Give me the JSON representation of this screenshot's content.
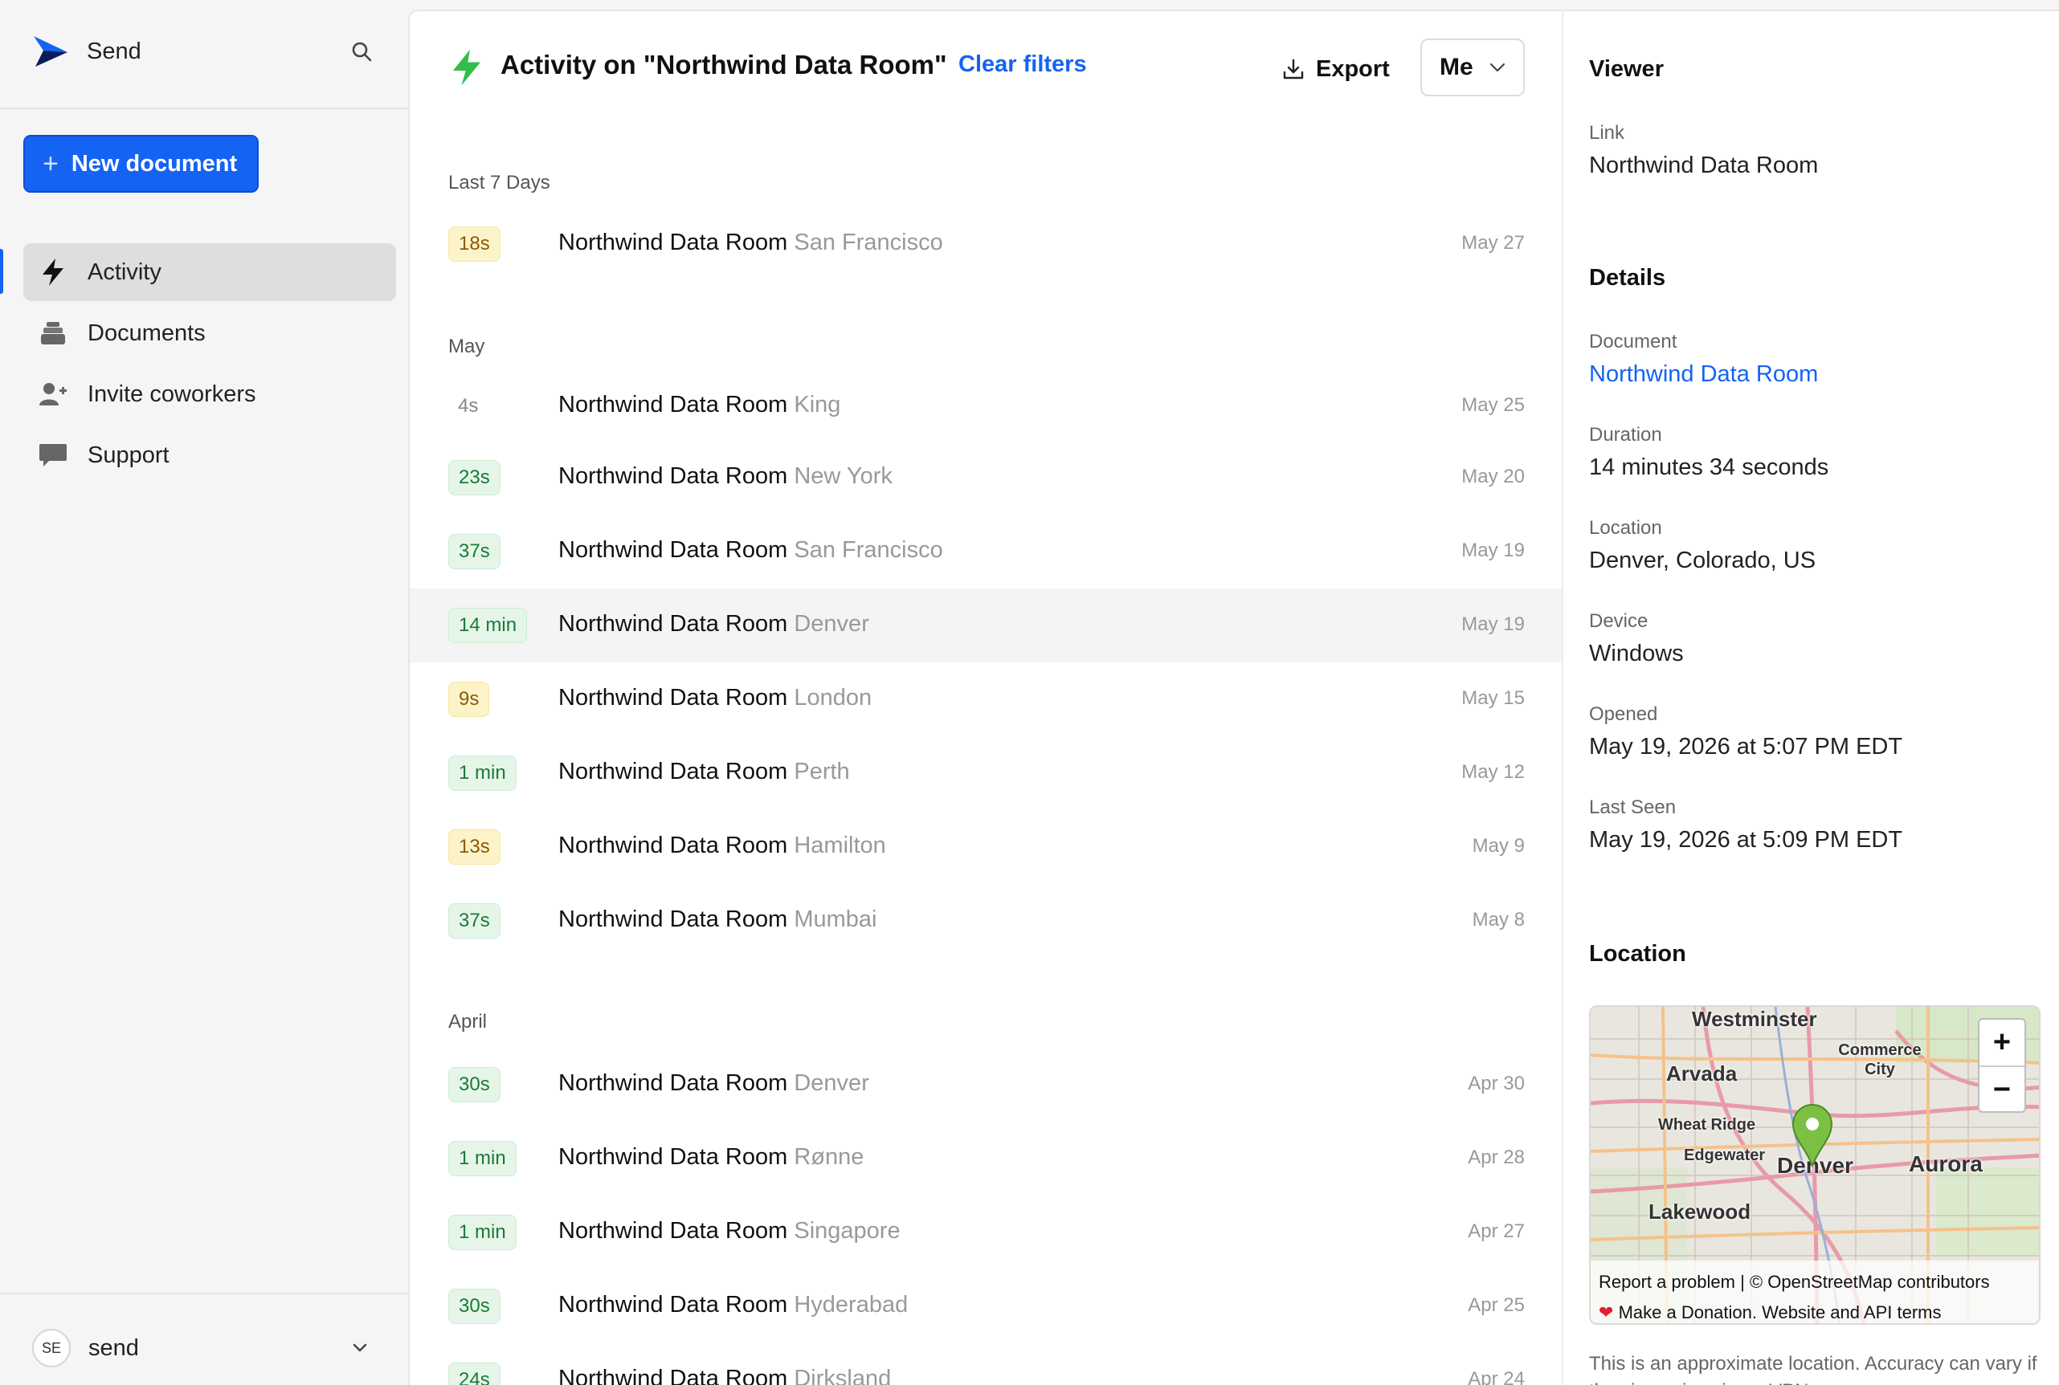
{
  "sidebar": {
    "brand": "Send",
    "new_document": "New document",
    "nav": [
      {
        "label": "Activity",
        "icon": "bolt-icon"
      },
      {
        "label": "Documents",
        "icon": "documents-icon"
      },
      {
        "label": "Invite coworkers",
        "icon": "user-plus-icon"
      },
      {
        "label": "Support",
        "icon": "chat-icon"
      }
    ],
    "account": {
      "initials": "SE",
      "name": "send"
    }
  },
  "main": {
    "title": "Activity on \"Northwind Data Room\"",
    "clear_filters": "Clear filters",
    "export": "Export",
    "filter": "Me",
    "sections": [
      {
        "label": "Last 7 Days",
        "rows": [
          {
            "duration": "18s",
            "doc": "Northwind Data Room",
            "location": "San Francisco",
            "date": "May 27",
            "badge": "yellow"
          }
        ]
      },
      {
        "label": "May",
        "rows": [
          {
            "duration": "4s",
            "doc": "Northwind Data Room",
            "location": "King",
            "date": "May 25",
            "badge": "plain"
          },
          {
            "duration": "23s",
            "doc": "Northwind Data Room",
            "location": "New York",
            "date": "May 20",
            "badge": "green"
          },
          {
            "duration": "37s",
            "doc": "Northwind Data Room",
            "location": "San Francisco",
            "date": "May 19",
            "badge": "green"
          },
          {
            "duration": "14 min",
            "doc": "Northwind Data Room",
            "location": "Denver",
            "date": "May 19",
            "badge": "green",
            "selected": true
          },
          {
            "duration": "9s",
            "doc": "Northwind Data Room",
            "location": "London",
            "date": "May 15",
            "badge": "yellow"
          },
          {
            "duration": "1 min",
            "doc": "Northwind Data Room",
            "location": "Perth",
            "date": "May 12",
            "badge": "green"
          },
          {
            "duration": "13s",
            "doc": "Northwind Data Room",
            "location": "Hamilton",
            "date": "May 9",
            "badge": "yellow"
          },
          {
            "duration": "37s",
            "doc": "Northwind Data Room",
            "location": "Mumbai",
            "date": "May 8",
            "badge": "green"
          }
        ]
      },
      {
        "label": "April",
        "rows": [
          {
            "duration": "30s",
            "doc": "Northwind Data Room",
            "location": "Denver",
            "date": "Apr 30",
            "badge": "green"
          },
          {
            "duration": "1 min",
            "doc": "Northwind Data Room",
            "location": "Rønne",
            "date": "Apr 28",
            "badge": "green"
          },
          {
            "duration": "1 min",
            "doc": "Northwind Data Room",
            "location": "Singapore",
            "date": "Apr 27",
            "badge": "green"
          },
          {
            "duration": "30s",
            "doc": "Northwind Data Room",
            "location": "Hyderabad",
            "date": "Apr 25",
            "badge": "green"
          },
          {
            "duration": "24s",
            "doc": "Northwind Data Room",
            "location": "Dirksland",
            "date": "Apr 24",
            "badge": "green"
          }
        ]
      }
    ]
  },
  "panel": {
    "viewer_heading": "Viewer",
    "link_label": "Link",
    "link_value": "Northwind Data Room",
    "details_heading": "Details",
    "document_label": "Document",
    "document_value": "Northwind Data Room",
    "duration_label": "Duration",
    "duration_value": "14 minutes 34 seconds",
    "location_label": "Location",
    "location_value": "Denver, Colorado, US",
    "device_label": "Device",
    "device_value": "Windows",
    "opened_label": "Opened",
    "opened_value": "May 19, 2026 at 5:07 PM EDT",
    "last_seen_label": "Last Seen",
    "last_seen_value": "May 19, 2026 at 5:09 PM EDT",
    "location_heading": "Location",
    "map": {
      "labels": {
        "westminster": "Westminster",
        "arvada": "Arvada",
        "commerce_city": "Commerce City",
        "wheat_ridge": "Wheat Ridge",
        "edgewater": "Edgewater",
        "denver": "Denver",
        "aurora": "Aurora",
        "lakewood": "Lakewood"
      },
      "zoom_in": "+",
      "zoom_out": "−",
      "attribution_1": "Report a problem | © OpenStreetMap contributors",
      "attribution_2": "Make a Donation. Website and API terms"
    },
    "map_note": "This is an approximate location. Accuracy can vary if the viewer is using a VPN or proxy."
  },
  "colors": {
    "accent": "#1463f3",
    "bolt_green": "#2fbf4a",
    "badge_green_bg": "#e5f6e9",
    "badge_yellow_bg": "#fdf3c9",
    "selected_row": "#f4f4f4"
  }
}
